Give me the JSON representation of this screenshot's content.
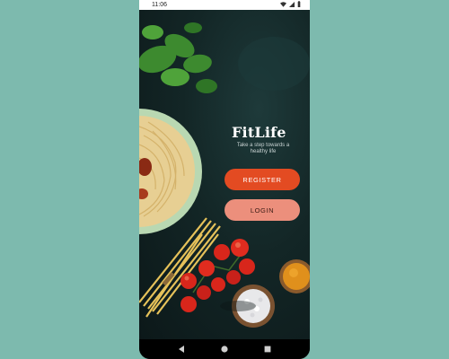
{
  "status_bar": {
    "time": "11:06"
  },
  "app": {
    "title": "FitLife",
    "tagline": "Take a step towards a healthy life"
  },
  "buttons": {
    "register_label": "REGISTER",
    "login_label": "LOGIN"
  },
  "nav_bar": {
    "items": [
      "back-icon",
      "home-icon",
      "recents-icon"
    ]
  },
  "colors": {
    "background": "#7dbaae",
    "register": "#e34b22",
    "login": "#ec8f7c",
    "screen": "#132626"
  }
}
